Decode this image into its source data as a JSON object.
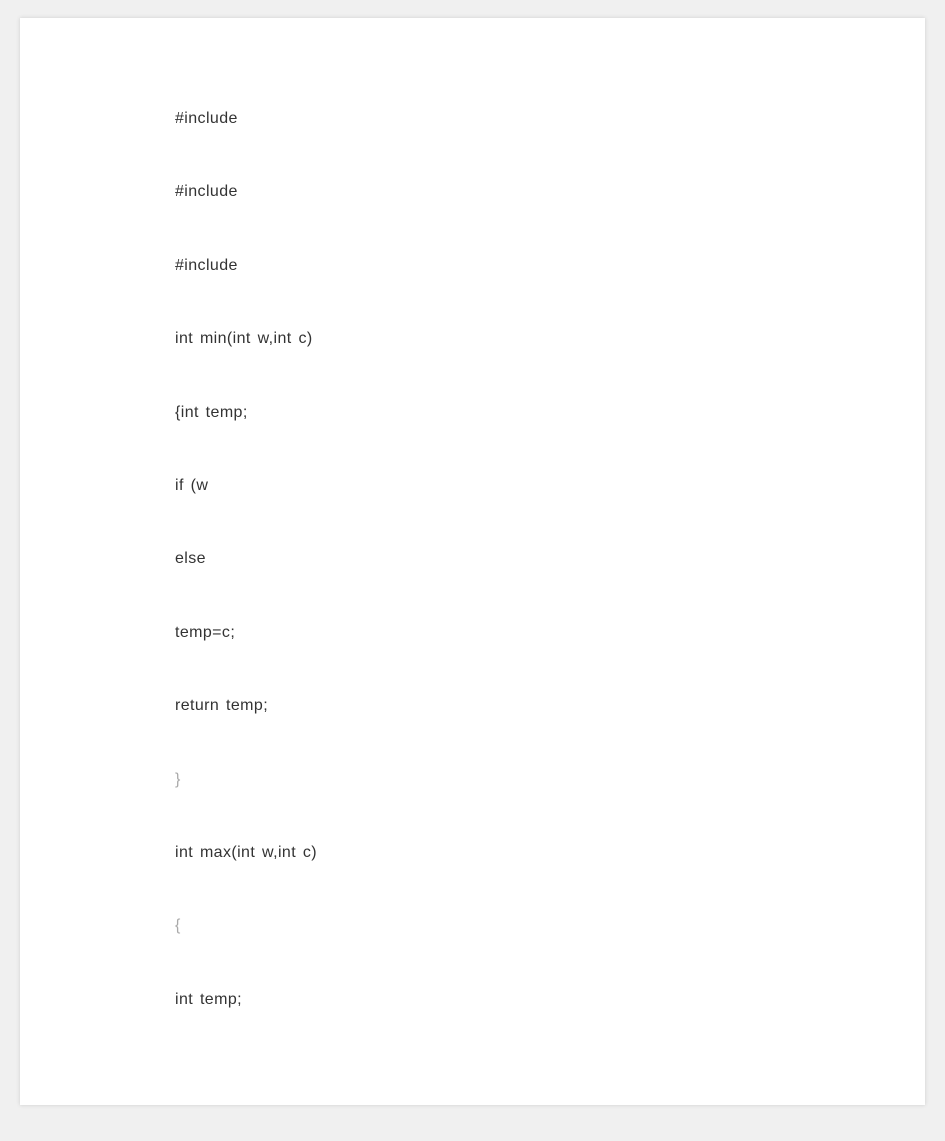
{
  "code": {
    "lines": [
      {
        "text": "#include",
        "pale": false
      },
      {
        "text": "#include",
        "pale": false
      },
      {
        "text": "#include",
        "pale": false
      },
      {
        "text": "int min(int w,int c)",
        "pale": false
      },
      {
        "text": "{int temp;",
        "pale": false
      },
      {
        "text": "if (w",
        "pale": false
      },
      {
        "text": "else",
        "pale": false
      },
      {
        "text": "temp=c;",
        "pale": false
      },
      {
        "text": "return temp;",
        "pale": false
      },
      {
        "text": "}",
        "pale": true
      },
      {
        "text": "int max(int w,int c)",
        "pale": false
      },
      {
        "text": "{",
        "pale": true
      },
      {
        "text": "int temp;",
        "pale": false
      }
    ]
  }
}
